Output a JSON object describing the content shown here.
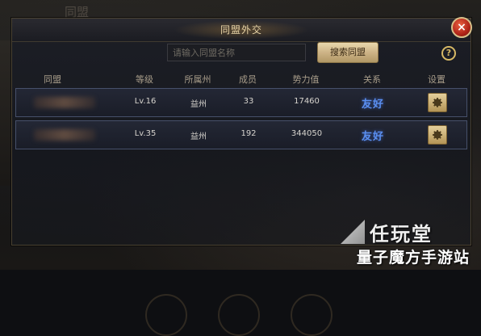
{
  "background": {
    "title": "同盟"
  },
  "dialog": {
    "title": "同盟外交",
    "close_label": "×",
    "search": {
      "placeholder": "请输入同盟名称",
      "button": "搜索同盟"
    },
    "help_label": "?",
    "columns": [
      "同盟",
      "等级",
      "所属州",
      "成员",
      "势力值",
      "关系",
      "设置"
    ],
    "rows": [
      {
        "level": "Lv.16",
        "region": "益州",
        "members": "33",
        "power": "17460",
        "relation": "友好"
      },
      {
        "level": "Lv.35",
        "region": "益州",
        "members": "192",
        "power": "344050",
        "relation": "友好"
      }
    ]
  },
  "watermark": {
    "line1": "任玩堂",
    "line2": "量子魔方手游站"
  },
  "colors": {
    "accent_gold": "#d6b865",
    "relation_blue": "#5a8ff0",
    "close_red": "#b02418"
  }
}
